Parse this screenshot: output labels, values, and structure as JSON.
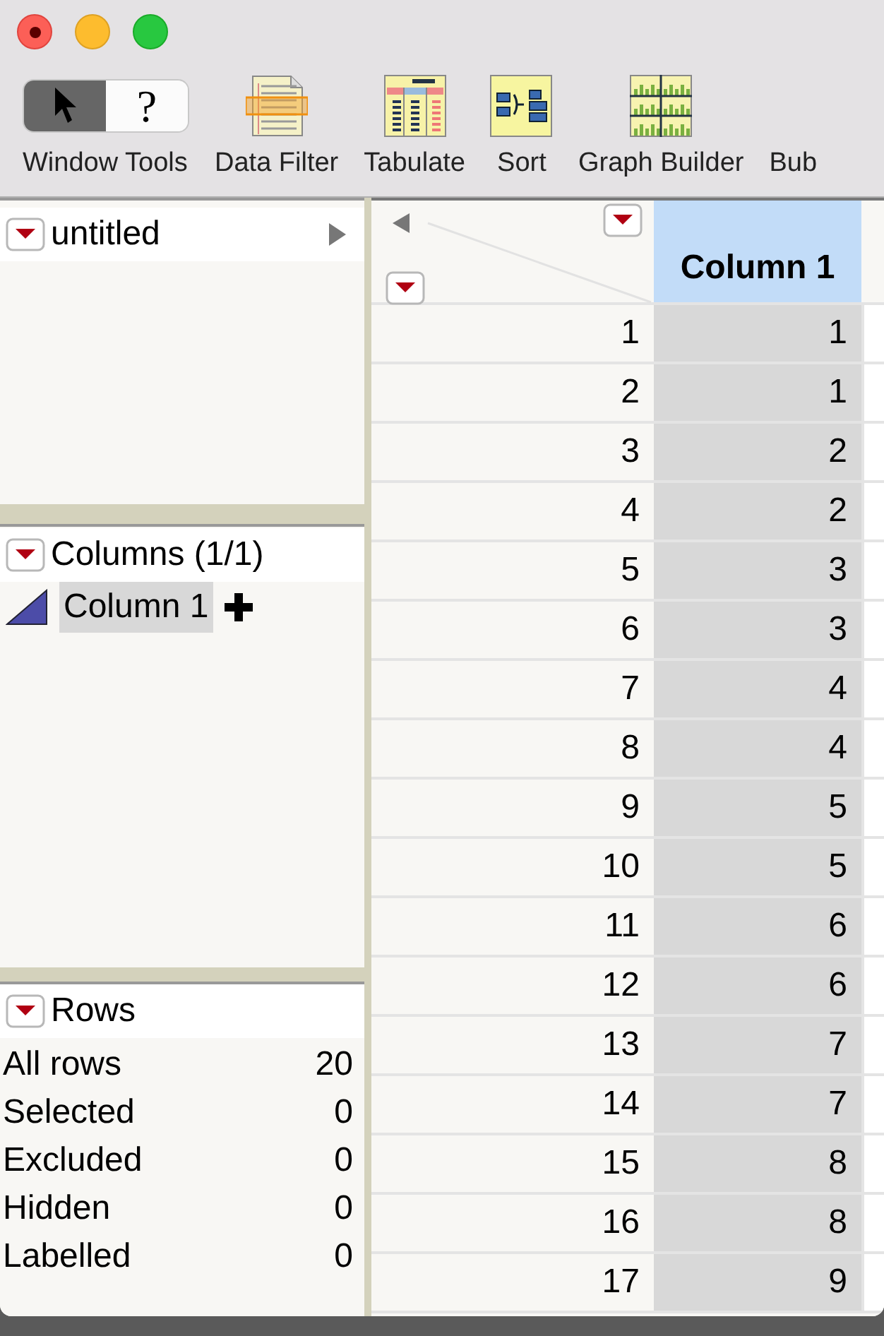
{
  "toolbar": {
    "tools": {
      "label": "Window Tools",
      "segments": [
        {
          "kind": "arrow",
          "selected": true
        },
        {
          "kind": "text",
          "text": "?",
          "selected": false
        }
      ]
    },
    "buttons": [
      {
        "kind": "filter",
        "label": "Data Filter"
      },
      {
        "kind": "tabulate",
        "label": "Tabulate"
      },
      {
        "kind": "sort",
        "label": "Sort"
      },
      {
        "kind": "graph",
        "label": "Graph Builder"
      },
      {
        "kind": "none",
        "label": "Bub"
      }
    ]
  },
  "table_panel": {
    "title": "untitled"
  },
  "columns_panel": {
    "title": "Columns (1/1)",
    "columns": [
      {
        "name": "Column 1",
        "selected": true
      }
    ]
  },
  "rows_panel": {
    "title": "Rows",
    "stats": [
      {
        "label": "All rows",
        "value": "20"
      },
      {
        "label": "Selected",
        "value": "0"
      },
      {
        "label": "Excluded",
        "value": "0"
      },
      {
        "label": "Hidden",
        "value": "0"
      },
      {
        "label": "Labelled",
        "value": "0"
      }
    ]
  },
  "grid": {
    "columns": [
      {
        "name": "Column 1",
        "selected": true
      }
    ],
    "rows": [
      {
        "number": "1",
        "cells": [
          "1"
        ]
      },
      {
        "number": "2",
        "cells": [
          "1"
        ]
      },
      {
        "number": "3",
        "cells": [
          "2"
        ]
      },
      {
        "number": "4",
        "cells": [
          "2"
        ]
      },
      {
        "number": "5",
        "cells": [
          "3"
        ]
      },
      {
        "number": "6",
        "cells": [
          "3"
        ]
      },
      {
        "number": "7",
        "cells": [
          "4"
        ]
      },
      {
        "number": "8",
        "cells": [
          "4"
        ]
      },
      {
        "number": "9",
        "cells": [
          "5"
        ]
      },
      {
        "number": "10",
        "cells": [
          "5"
        ]
      },
      {
        "number": "11",
        "cells": [
          "6"
        ]
      },
      {
        "number": "12",
        "cells": [
          "6"
        ]
      },
      {
        "number": "13",
        "cells": [
          "7"
        ]
      },
      {
        "number": "14",
        "cells": [
          "7"
        ]
      },
      {
        "number": "15",
        "cells": [
          "8"
        ]
      },
      {
        "number": "16",
        "cells": [
          "8"
        ]
      },
      {
        "number": "17",
        "cells": [
          "9"
        ]
      }
    ]
  }
}
